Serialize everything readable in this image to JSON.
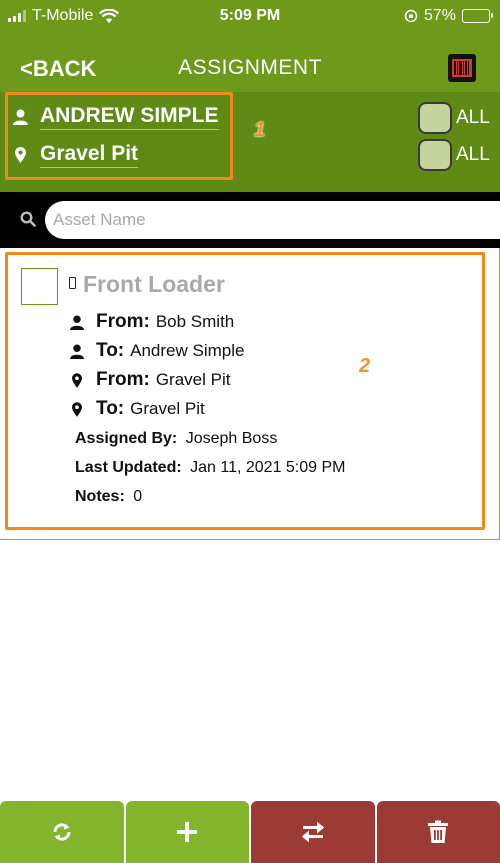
{
  "status_bar": {
    "carrier": "T-Mobile",
    "time": "5:09 PM",
    "battery": "57%",
    "battery_level": 0.57
  },
  "nav": {
    "back_label": "<BACK",
    "title": "ASSIGNMENT",
    "barcode_icon": "barcode-scanner-icon"
  },
  "filter": {
    "user_name": "ANDREW SIMPLE",
    "location": "Gravel Pit",
    "all_label_1": "ALL",
    "all_label_2": "ALL",
    "annotation_1": "1"
  },
  "search": {
    "placeholder": "Asset Name",
    "value": ""
  },
  "items": [
    {
      "title": "Front Loader",
      "from_user_label": "From:",
      "from_user": "Bob Smith",
      "to_user_label": "To:",
      "to_user": "Andrew Simple",
      "from_location_label": "From:",
      "from_location": "Gravel Pit",
      "to_location_label": "To:",
      "to_location": "Gravel Pit",
      "assigned_by_label": "Assigned By:",
      "assigned_by": "Joseph Boss",
      "last_updated_label": "Last Updated:",
      "last_updated": "Jan 11, 2021 5:09 PM",
      "notes_label": "Notes:",
      "notes": "0",
      "annotation": "2"
    }
  ],
  "toolbar": {
    "buttons": [
      "refresh-icon",
      "add-icon",
      "transfer-icon",
      "trash-icon"
    ]
  },
  "colors": {
    "header_green": "#6e9a1c",
    "filter_green": "#5f8a16",
    "button_green": "#84b52f",
    "button_red": "#9c3b36",
    "annotation_orange": "#f08a1c"
  }
}
